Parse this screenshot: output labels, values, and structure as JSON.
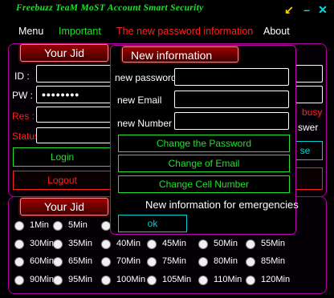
{
  "window": {
    "title": "Freebuzz TeaM MoST Account Smart Security",
    "minimize_glyph": "↙",
    "hyphen_glyph": "–",
    "close_glyph": "✕"
  },
  "menu": {
    "menu": "Menu",
    "important": "Important",
    "new_password_info": "The new password information",
    "about": "About"
  },
  "jid_panel": {
    "header": "Your Jid",
    "id_label": "ID :",
    "pw_label": "PW :",
    "pw_value": "••••••••",
    "res_label": "Res :",
    "status_label": "Status",
    "login": "Login",
    "logout": "Logout",
    "partial_busy": "busy",
    "partial_swer": "swer",
    "partial_se": "se"
  },
  "timer_panel": {
    "header": "Your Jid",
    "rows": [
      [
        "1Min",
        "5Min",
        "1",
        "",
        "",
        "",
        ""
      ],
      [
        "30Min",
        "35Min",
        "40Min",
        "45Min",
        "50Min",
        "55Min"
      ],
      [
        "60Min",
        "65Min",
        "70Min",
        "75Min",
        "80Min",
        "85Min"
      ],
      [
        "90Min",
        "95Min",
        "100Min",
        "105Min",
        "110Min",
        "120Min"
      ]
    ]
  },
  "dialog": {
    "header": "New information",
    "new_password_label": "new password",
    "new_email_label": "new Email",
    "new_number_label": "new Number",
    "change_password": "Change the Password",
    "change_email": "Change of Email",
    "change_cell": "Change Cell Number",
    "emergency_text": "New information for emergencies",
    "ok": "ok"
  },
  "colors": {
    "accent_green": "#20e030",
    "accent_red": "#ff2020",
    "accent_cyan": "#00d0d0",
    "border_magenta": "#b000a0"
  }
}
